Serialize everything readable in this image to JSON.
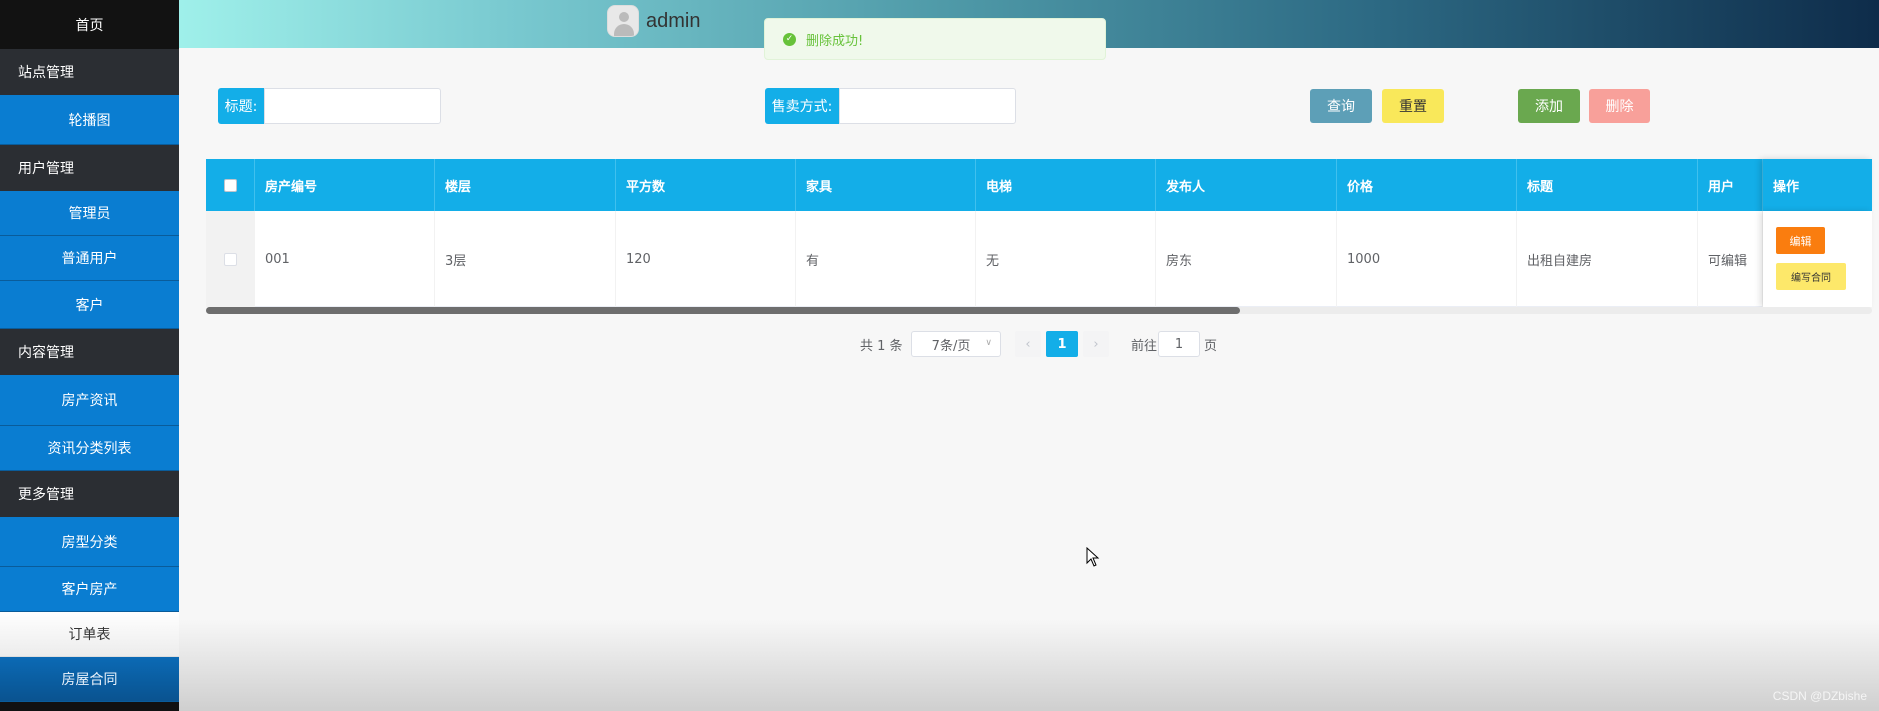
{
  "sidebar": {
    "home": "首页",
    "groups": [
      {
        "label": "站点管理",
        "items": [
          "轮播图"
        ]
      },
      {
        "label": "用户管理",
        "items": [
          "管理员",
          "普通用户",
          "客户"
        ]
      },
      {
        "label": "内容管理",
        "items": [
          "房产资讯",
          "资讯分类列表"
        ]
      },
      {
        "label": "更多管理",
        "items": [
          "房型分类",
          "客户房产",
          "订单表",
          "房屋合同"
        ]
      }
    ]
  },
  "header": {
    "username": "admin"
  },
  "toast": {
    "message": "删除成功!"
  },
  "search": {
    "title_label": "标题:",
    "title_value": "",
    "sale_label": "售卖方式:",
    "sale_value": "",
    "query_btn": "查询",
    "reset_btn": "重置",
    "add_btn": "添加",
    "delete_btn": "删除"
  },
  "table": {
    "columns": [
      "房产编号",
      "楼层",
      "平方数",
      "家具",
      "电梯",
      "发布人",
      "价格",
      "标题",
      "用户",
      "操作"
    ],
    "rows": [
      {
        "cells": [
          "001",
          "3层",
          "120",
          "有",
          "无",
          "房东",
          "1000",
          "出租自建房",
          "可编辑"
        ],
        "edit_btn": "编辑",
        "contract_btn": "编写合同"
      }
    ]
  },
  "pagination": {
    "total": "共 1 条",
    "page_size": "7条/页",
    "current_page": "1",
    "goto_label": "前往",
    "goto_value": "1",
    "page_unit": "页"
  },
  "watermark": "CSDN @DZbishe",
  "colors": {
    "accent": "#13aee8",
    "nav_blue": "#0a7dd1",
    "success": "#67c23a"
  }
}
